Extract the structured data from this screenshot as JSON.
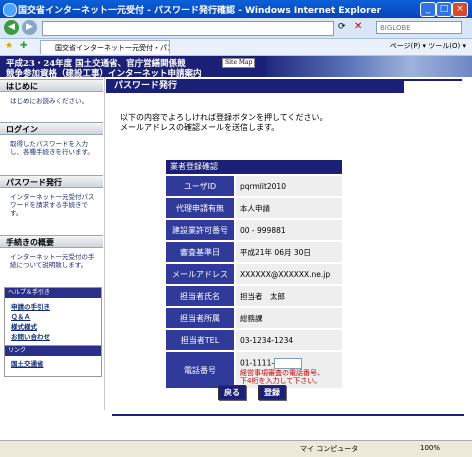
{
  "window": {
    "title": "国交省インターネット一元受付 - パスワード発行確認 - Windows Internet Explorer",
    "tab_title": "国交省インターネット一元受付・パスワード発行確認",
    "search_placeholder": "BIGLOBE",
    "tools": "ページ(P) ▾  ツール(O) ▾",
    "status_zone": "マイ コンピュータ",
    "zoom": "100%"
  },
  "banner": {
    "line1": "平成23・24年度 国土交通省、官庁営繕関係競",
    "line2": "競争参加資格（建設工事）インターネット申請案内",
    "sitemap": "Site Map"
  },
  "sidebar": {
    "sections": [
      {
        "title": "はじめに",
        "text": "はじめにお読みください。"
      },
      {
        "title": "ログイン",
        "text": "取得したパスワードを入力し、各種手続きを行います。"
      },
      {
        "title": "パスワード発行",
        "text": "インターネット一元受付パスワードを請求する手続きです。"
      },
      {
        "title": "手続きの概要",
        "text": "インターネット一元受付の手続について説明致します。"
      }
    ],
    "help_title": "ヘルプ＆手引き",
    "help_items": [
      "申請の手引き",
      "Ｑ＆Ａ",
      "様式様式",
      "お問い合わせ"
    ],
    "link_title": "リンク",
    "link_items": [
      "国土交通省"
    ]
  },
  "main": {
    "page_title": "パスワード発行",
    "intro_line1": "以下の内容でよろしければ登録ボタンを押してください。",
    "intro_line2": "メールアドレスの確認メールを送信します。",
    "table_caption": "業者登録確認",
    "rows": [
      {
        "label": "ユーザID",
        "value": "pqrmlit2010"
      },
      {
        "label": "代理申請有無",
        "value": "本人申請"
      },
      {
        "label": "建設業許可番号",
        "value": "00 - 999881"
      },
      {
        "label": "審査基準日",
        "value": "平成21年 06月 30日"
      },
      {
        "label": "メールアドレス",
        "value": "XXXXXX@XXXXXX.ne.jp"
      },
      {
        "label": "担当者氏名",
        "value": "担当者　太郎"
      },
      {
        "label": "担当者所属",
        "value": "総務課"
      },
      {
        "label": "担当者TEL",
        "value": "03-1234-1234"
      }
    ],
    "phone_label": "電話番号",
    "phone_prefix": "01-1111-",
    "phone_note1": "経営事項審査の電話番号、",
    "phone_note2": "下4桁を入力して下さい。",
    "back_button": "戻る",
    "register_button": "登録"
  }
}
